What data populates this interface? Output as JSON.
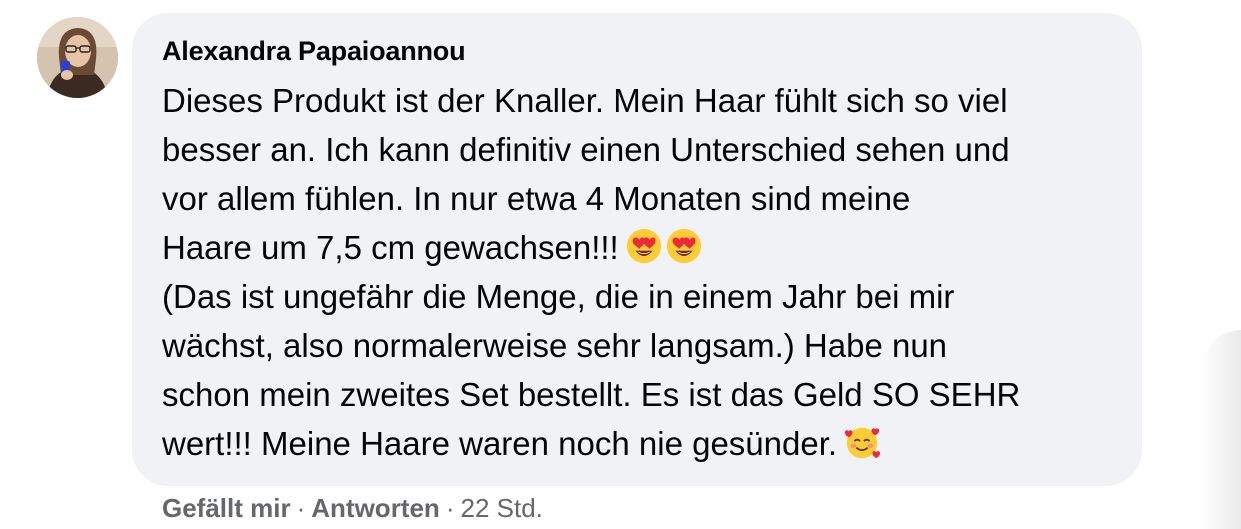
{
  "comment": {
    "author": "Alexandra Papaioannou",
    "lines": [
      "Dieses Produkt ist der Knaller. Mein Haar fühlt sich so viel",
      "besser an. Ich kann definitiv einen Unterschied sehen und",
      "vor allem fühlen. In nur etwa 4 Monaten sind meine",
      "Haare um 7,5 cm gewachsen!!!",
      "(Das ist ungefähr die Menge, die in einem Jahr bei mir",
      "wächst, also normalerweise sehr langsam.) Habe nun",
      "schon mein zweites Set bestellt. Es ist das Geld SO SEHR",
      "wert!!! Meine Haare waren noch nie gesünder."
    ],
    "emojis": [
      "heart-eyes-emoji",
      "heart-eyes-emoji",
      "smiling-face-with-hearts-emoji"
    ]
  },
  "actions": {
    "like_label": "Gefällt mir",
    "reply_label": "Antworten",
    "separator": "·",
    "timestamp": "22 Std."
  },
  "colors": {
    "bubble": "#f0f2f5",
    "text": "#050505",
    "meta": "#65676b"
  }
}
